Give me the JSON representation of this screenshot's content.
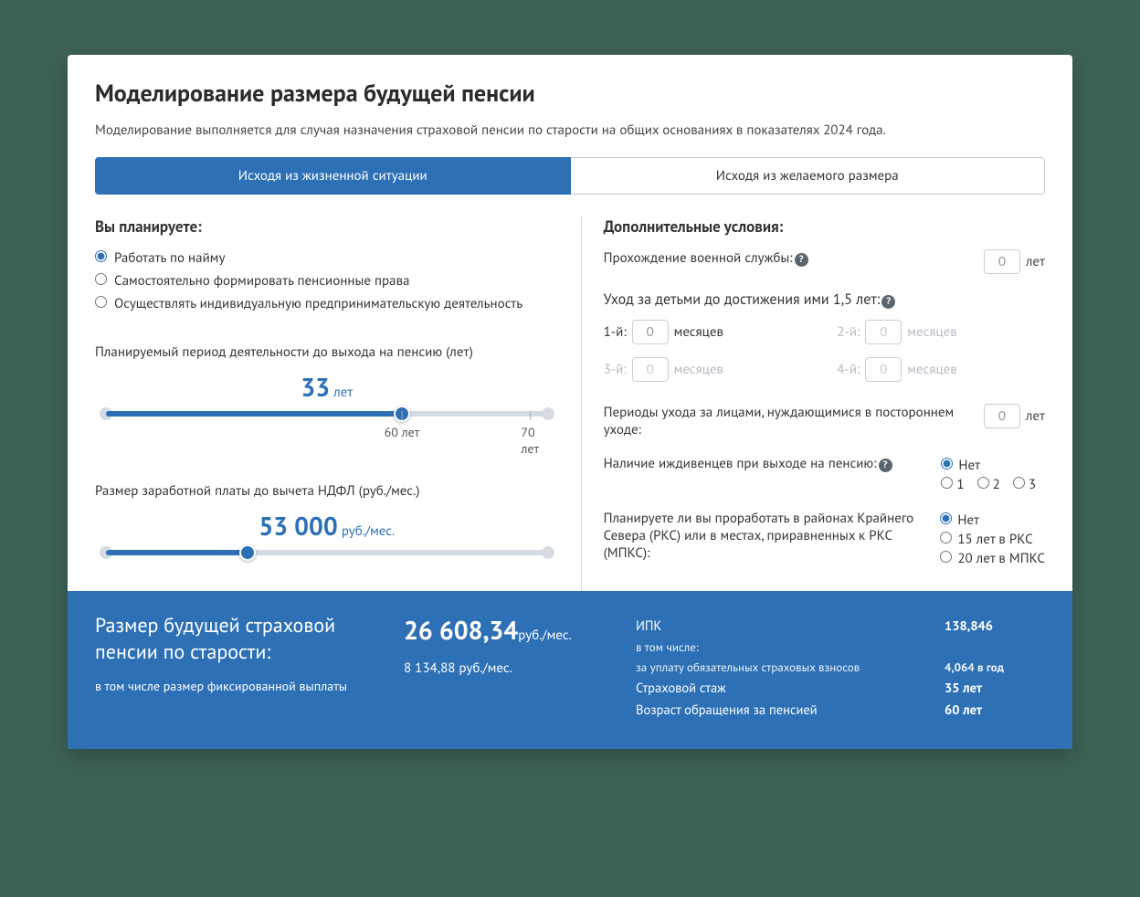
{
  "title": "Моделирование размера будущей пенсии",
  "subtitle": "Моделирование выполняется для случая назначения страховой пенсии по старости на общих основаниях в показателях 2024 года.",
  "tabs": {
    "situation": "Исходя из жизненной ситуации",
    "desired": "Исходя из желаемого размера"
  },
  "plan": {
    "heading": "Вы планируете:",
    "opt1": "Работать по найму",
    "opt2": "Самостоятельно формировать пенсионные права",
    "opt3": "Осуществлять индивидуальную предпринимательскую деятельность"
  },
  "period": {
    "label": "Планируемый период деятельности до выхода на пенсию (лет)",
    "value": "33",
    "unit": "лет",
    "mark60": "60 лет",
    "mark70": "70 лет"
  },
  "salary": {
    "label": "Размер заработной платы до вычета НДФЛ (руб./мес.)",
    "value": "53 000",
    "unit": "руб./мес."
  },
  "extra": {
    "heading": "Дополнительные условия:",
    "military_label": "Прохождение военной службы:",
    "military_val": "0",
    "years": "лет",
    "childcare_label": "Уход за детьми до достижения ими 1,5 лет:",
    "c1": "1-й:",
    "c2": "2-й:",
    "c3": "3-й:",
    "c4": "4-й:",
    "months": "месяцев",
    "zero": "0",
    "care_label": "Периоды ухода за лицами, нуждающимися в постороннем уходе:",
    "care_val": "0",
    "dependents_label": "Наличие иждивенцев при выходе на пенсию:",
    "no": "Нет",
    "d1": "1",
    "d2": "2",
    "d3": "3",
    "north_label": "Планируете ли вы проработать в районах Крайнего Севера (РКС) или в местах, приравненных к РКС (МПКС):",
    "n1": "15 лет в РКС",
    "n2": "20 лет в МПКС"
  },
  "result": {
    "title": "Размер будущей страховой пенсии по старости:",
    "fixed_lab": "в том числе размер фиксированной выплаты",
    "amount": "26 608,34",
    "amount_unit": "руб./мес.",
    "fixed": "8 134,88 руб./мес.",
    "ipk_lab": "ИПК",
    "ipk_val": "138,846",
    "incl": "в том числе:",
    "contrib_lab": "за уплату обязательных страховых взносов",
    "contrib_val": "4,064 в год",
    "stazh_lab": "Страховой стаж",
    "stazh_val": "35 лет",
    "age_lab": "Возраст обращения за пенсией",
    "age_val": "60 лет"
  }
}
